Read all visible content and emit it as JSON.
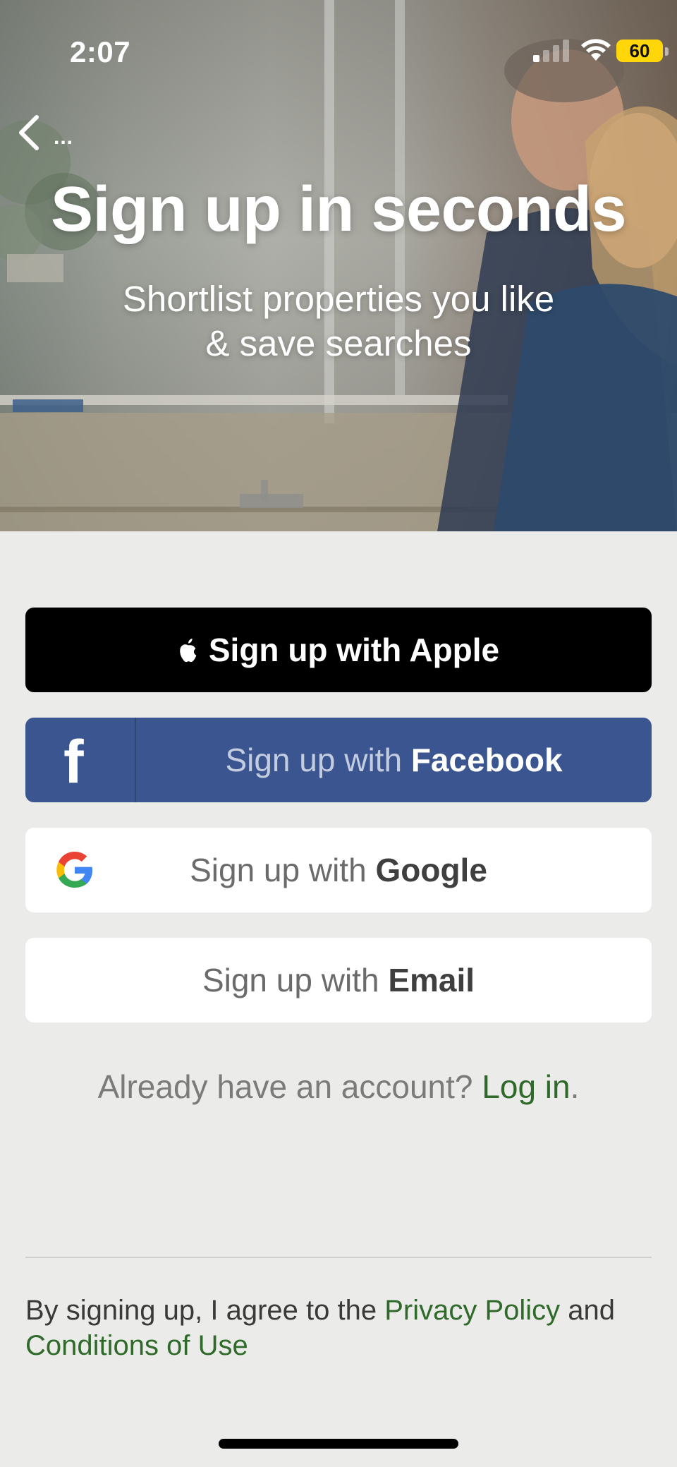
{
  "status_bar": {
    "time": "2:07",
    "battery": "60",
    "icons": [
      "signal-icon",
      "wifi-icon",
      "battery-icon"
    ]
  },
  "nav": {
    "back_icon": "chevron-left-icon",
    "back_dots": "..."
  },
  "hero": {
    "title": "Sign up in seconds",
    "subtitle_line1": "Shortlist properties you like",
    "subtitle_line2": "& save searches"
  },
  "buttons": {
    "apple": {
      "label": "Sign up with Apple",
      "icon": "apple-icon"
    },
    "facebook": {
      "prefix": "Sign up with ",
      "brand": "Facebook",
      "icon": "facebook-icon",
      "color": "#3b5590"
    },
    "google": {
      "prefix": "Sign up with ",
      "brand": "Google",
      "icon": "google-icon"
    },
    "email": {
      "prefix": "Sign up with ",
      "brand": "Email"
    }
  },
  "login": {
    "text": "Already have an account? ",
    "link": "Log in",
    "suffix": "."
  },
  "legal": {
    "text": "By signing up, I agree to the ",
    "privacy_link": "Privacy Policy",
    "and": " and",
    "conditions_link": "Conditions of Use"
  },
  "colors": {
    "link_green": "#2f6a2a",
    "background": "#ebebe9"
  }
}
